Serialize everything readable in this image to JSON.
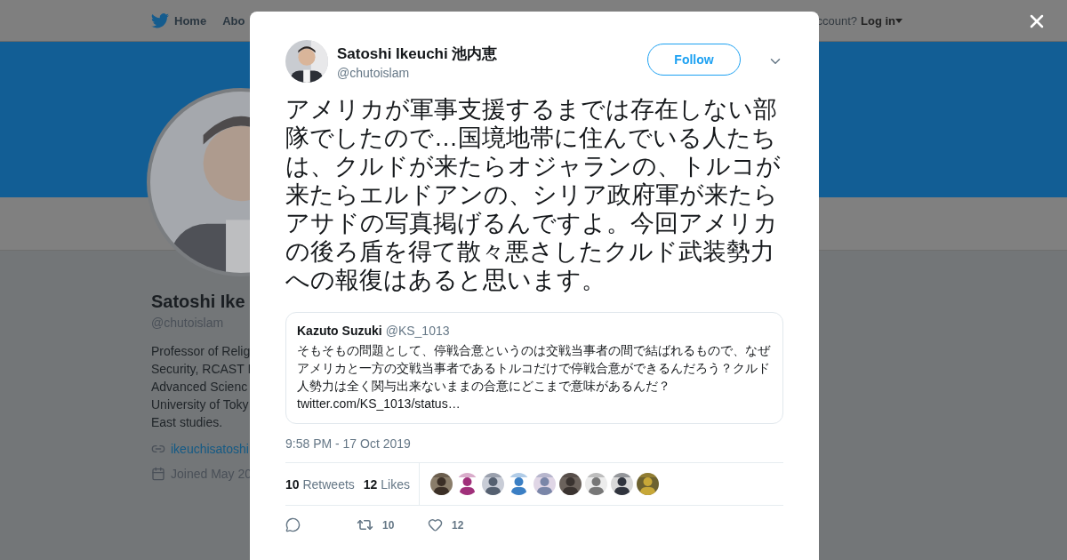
{
  "top_nav": {
    "items": [
      {
        "label": "Home",
        "kind": "logo"
      },
      {
        "label": "Abo",
        "kind": "plain"
      }
    ],
    "account_prompt": "ccount?",
    "login": "Log in"
  },
  "profile": {
    "name": "Satoshi Ike",
    "handle": "@chutoislam",
    "bio": [
      "Professor of Relig",
      "Security, RCAST I",
      "Advanced Scienc",
      "University of Toky",
      "East studies."
    ],
    "link": "ikeuchisatoshi",
    "joined": "Joined May 20"
  },
  "tweet": {
    "author": "Satoshi Ikeuchi 池内恵",
    "handle": "@chutoislam",
    "follow": "Follow",
    "text": "アメリカが軍事支援するまでは存在しない部隊でしたので…国境地帯に住んでいる人たちは、クルドが来たらオジャランの、トルコが来たらエルドアンの、シリア政府軍が来たらアサドの写真掲げるんですよ。今回アメリカの後ろ盾を得て散々悪さしたクルド武装勢力への報復はあると思います。",
    "quoted": {
      "name": "Kazuto Suzuki",
      "handle": "@KS_1013",
      "text": "そもそもの問題として、停戦合意というのは交戦当事者の間で結ばれるもので、なぜアメリカと一方の交戦当事者であるトルコだけで停戦合意ができるんだろう？クルド人勢力は全く関与出来ないままの合意にどこまで意味があるんだ？",
      "link": "twitter.com/KS_1013/status…"
    },
    "timestamp": "9:58 PM - 17 Oct 2019",
    "stats": [
      {
        "count": "10",
        "label": "Retweets"
      },
      {
        "count": "12",
        "label": "Likes"
      }
    ],
    "actions": [
      {
        "kind": "reply"
      },
      {
        "kind": "retweet",
        "count": "10"
      },
      {
        "kind": "like",
        "count": "12"
      }
    ]
  }
}
